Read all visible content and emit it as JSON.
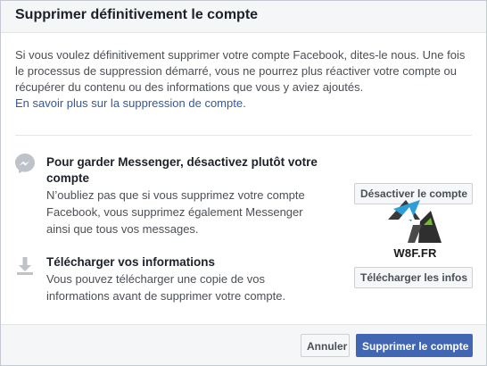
{
  "dialog": {
    "title": "Supprimer définitivement le compte",
    "intro_text": "Si vous voulez définitivement supprimer votre compte Facebook, dites-le nous. Une fois le processus de suppression démarré, vous ne pourrez plus réactiver votre compte ou récupérer du contenu ou des informations que vous y aviez ajoutés.",
    "learn_more_link": "En savoir plus sur la suppression de compte."
  },
  "options": [
    {
      "icon": "messenger-icon",
      "title": "Pour garder Messenger, désactivez plutôt votre compte",
      "description": "N’oubliez pas que si vous supprimez votre compte Facebook, vous supprimez également Messenger ainsi que tous vos messages.",
      "button_label": "Désactiver le compte"
    },
    {
      "icon": "download-icon",
      "title": "Télécharger vos informations",
      "description": "Vous pouvez télécharger une copie de vos informations avant de supprimer votre compte.",
      "button_label": "Télécharger les infos"
    }
  ],
  "watermark": {
    "text": "W8F.FR"
  },
  "footer": {
    "cancel_label": "Annuler",
    "confirm_label": "Supprimer le compte"
  },
  "colors": {
    "primary_button": "#4267b2",
    "link": "#365899",
    "header_background": "#f5f6f7"
  }
}
